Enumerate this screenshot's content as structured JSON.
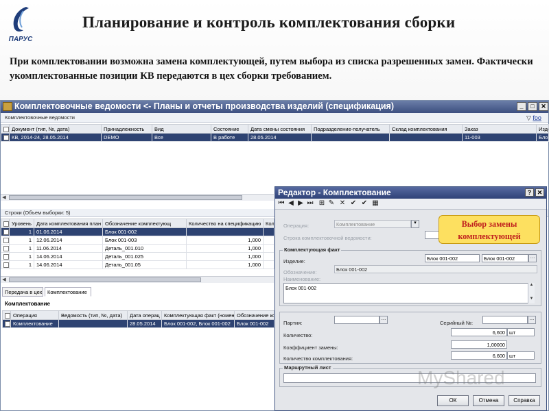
{
  "logo": {
    "text": "ПАРУС"
  },
  "slide": {
    "title": "Планирование и контроль комплектования сборки",
    "description": "При комплектовании возможна замена комплектующей, путем выбора из списка разрешенных замен. Фактически укомплектованные позиции КВ передаются в цех сборки требованием."
  },
  "window": {
    "title": "Комплектовочные ведомости <- Планы и отчеты производства изделий (спецификация)",
    "strip_label": "Комплектовочные ведомости",
    "filter_label": "foo",
    "minimize": "_",
    "restore": "□",
    "close": "✕",
    "top_table": {
      "columns": [
        "",
        "Документ (тип, №, дата)",
        "Принадлежность",
        "Вид",
        "Состояние",
        "Дата смены состояния",
        "Подразделение-получатель",
        "Склад комплектования",
        "Заказ",
        "Изде"
      ],
      "rows": [
        [
          "",
          "КВ, 2014-24, 28.05.2014",
          "DEMO",
          "Все",
          "В работе",
          "28.05.2014",
          "",
          "",
          "11-003",
          "Блок"
        ]
      ]
    },
    "rows_strip_label": "Строки (Объем выборки: 5)",
    "mid_table": {
      "columns": [
        "",
        "Уровень",
        "Дата комплектования план",
        "Обозначение комплектующ",
        "Количество на спецификацию",
        "Колі"
      ],
      "rows": [
        [
          "",
          "1",
          "01.06.2014",
          "Блок 001-002",
          "",
          ""
        ],
        [
          "",
          "1",
          "12.06.2014",
          "Блок 001-003",
          "1,000",
          ""
        ],
        [
          "",
          "1",
          "11.06.2014",
          "Деталь_001.010",
          "1,000",
          ""
        ],
        [
          "",
          "1",
          "14.06.2014",
          "Деталь_001.025",
          "1,000",
          ""
        ],
        [
          "",
          "1",
          "14.06.2014",
          "Деталь_001.05",
          "1,000",
          ""
        ]
      ]
    },
    "tabs": [
      "Передача в цех",
      "Комплектование"
    ],
    "bottom_heading": "Комплектование",
    "bottom_table": {
      "columns": [
        "",
        "Операция",
        "Ведомость (тип, №, дата)",
        "Дата операц",
        "Комплектующая факт (номен",
        "Обозначение комп"
      ],
      "rows": [
        [
          "",
          "Комплектование",
          "",
          "28.05.2014",
          "Блок 001-002, Блок 001-002",
          "Блок 001-002"
        ]
      ]
    }
  },
  "dialog": {
    "title": "Редактор - Комплектование",
    "help": "?",
    "close": "✕",
    "toolbar": [
      "⏮",
      "◀",
      "▶",
      "⏭",
      "⊞",
      "✎",
      "✕",
      "✔",
      "✔",
      "▦"
    ],
    "operation_label": "Операция:",
    "operation_value": "Комплектование",
    "stroke_label": "Строка комплектовочной ведомости:",
    "group_component": "Комплектующая факт",
    "item_label": "Изделие:",
    "item_value1": "Блок 001-002",
    "item_value2": "Блок 001-002",
    "designation_label": "Обозначение:",
    "designation_value": "Блок 001-002",
    "name_label": "Наименование:",
    "name_value": "Блок 001-002",
    "party_label": "Партия:",
    "serial_label": "Серийный №:",
    "qty_label": "Количество:",
    "qty_value": "6,600",
    "qty_unit": "шт",
    "coef_label": "Коэффициент замены:",
    "coef_value": "1,00000",
    "qty_kompl_label": "Количество комплектования:",
    "qty_kompl_value": "6,600",
    "qty_kompl_unit": "шт",
    "route_label": "Маршрутный лист",
    "ok": "ОК",
    "cancel": "Отмена",
    "help_btn": "Справка"
  },
  "callout": {
    "line1": "Выбор замены",
    "line2": "комплектующей"
  },
  "watermark": "MyShared"
}
